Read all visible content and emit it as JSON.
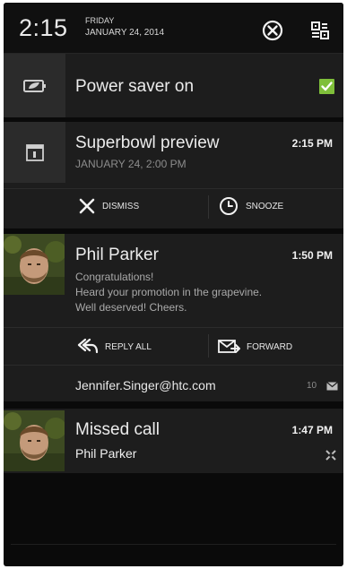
{
  "status": {
    "time": "2:15",
    "day": "FRIDAY",
    "date": "JANUARY 24, 2014"
  },
  "header_icons": [
    "clear-all-icon",
    "quick-settings-icon"
  ],
  "power_saver": {
    "title": "Power saver on",
    "checked": true,
    "icon": "battery-leaf-icon"
  },
  "superbowl": {
    "title": "Superbowl preview",
    "time": "2:15 PM",
    "subtitle": "JANUARY 24, 2:00 PM",
    "icon": "calendar-icon",
    "actions": [
      {
        "label": "DISMISS",
        "icon": "close-icon"
      },
      {
        "label": "SNOOZE",
        "icon": "clock-icon"
      }
    ]
  },
  "email": {
    "name": "Phil Parker",
    "time": "1:50 PM",
    "lines": [
      "Congratulations!",
      "Heard your promotion in the grapevine.",
      "Well deserved! Cheers."
    ],
    "actions": [
      {
        "label": "REPLY ALL",
        "icon": "reply-all-icon"
      },
      {
        "label": "FORWARD",
        "icon": "forward-mail-icon"
      }
    ],
    "account": "Jennifer.Singer@htc.com",
    "count": "10",
    "count_icon": "mail-icon"
  },
  "missed_call": {
    "title": "Missed call",
    "time": "1:47 PM",
    "caller": "Phil Parker",
    "icon": "missed-call-icon"
  },
  "colors": {
    "background": "#0a0a0a",
    "card": "#1d1d1d",
    "accent_check": "#7fbf3a"
  }
}
